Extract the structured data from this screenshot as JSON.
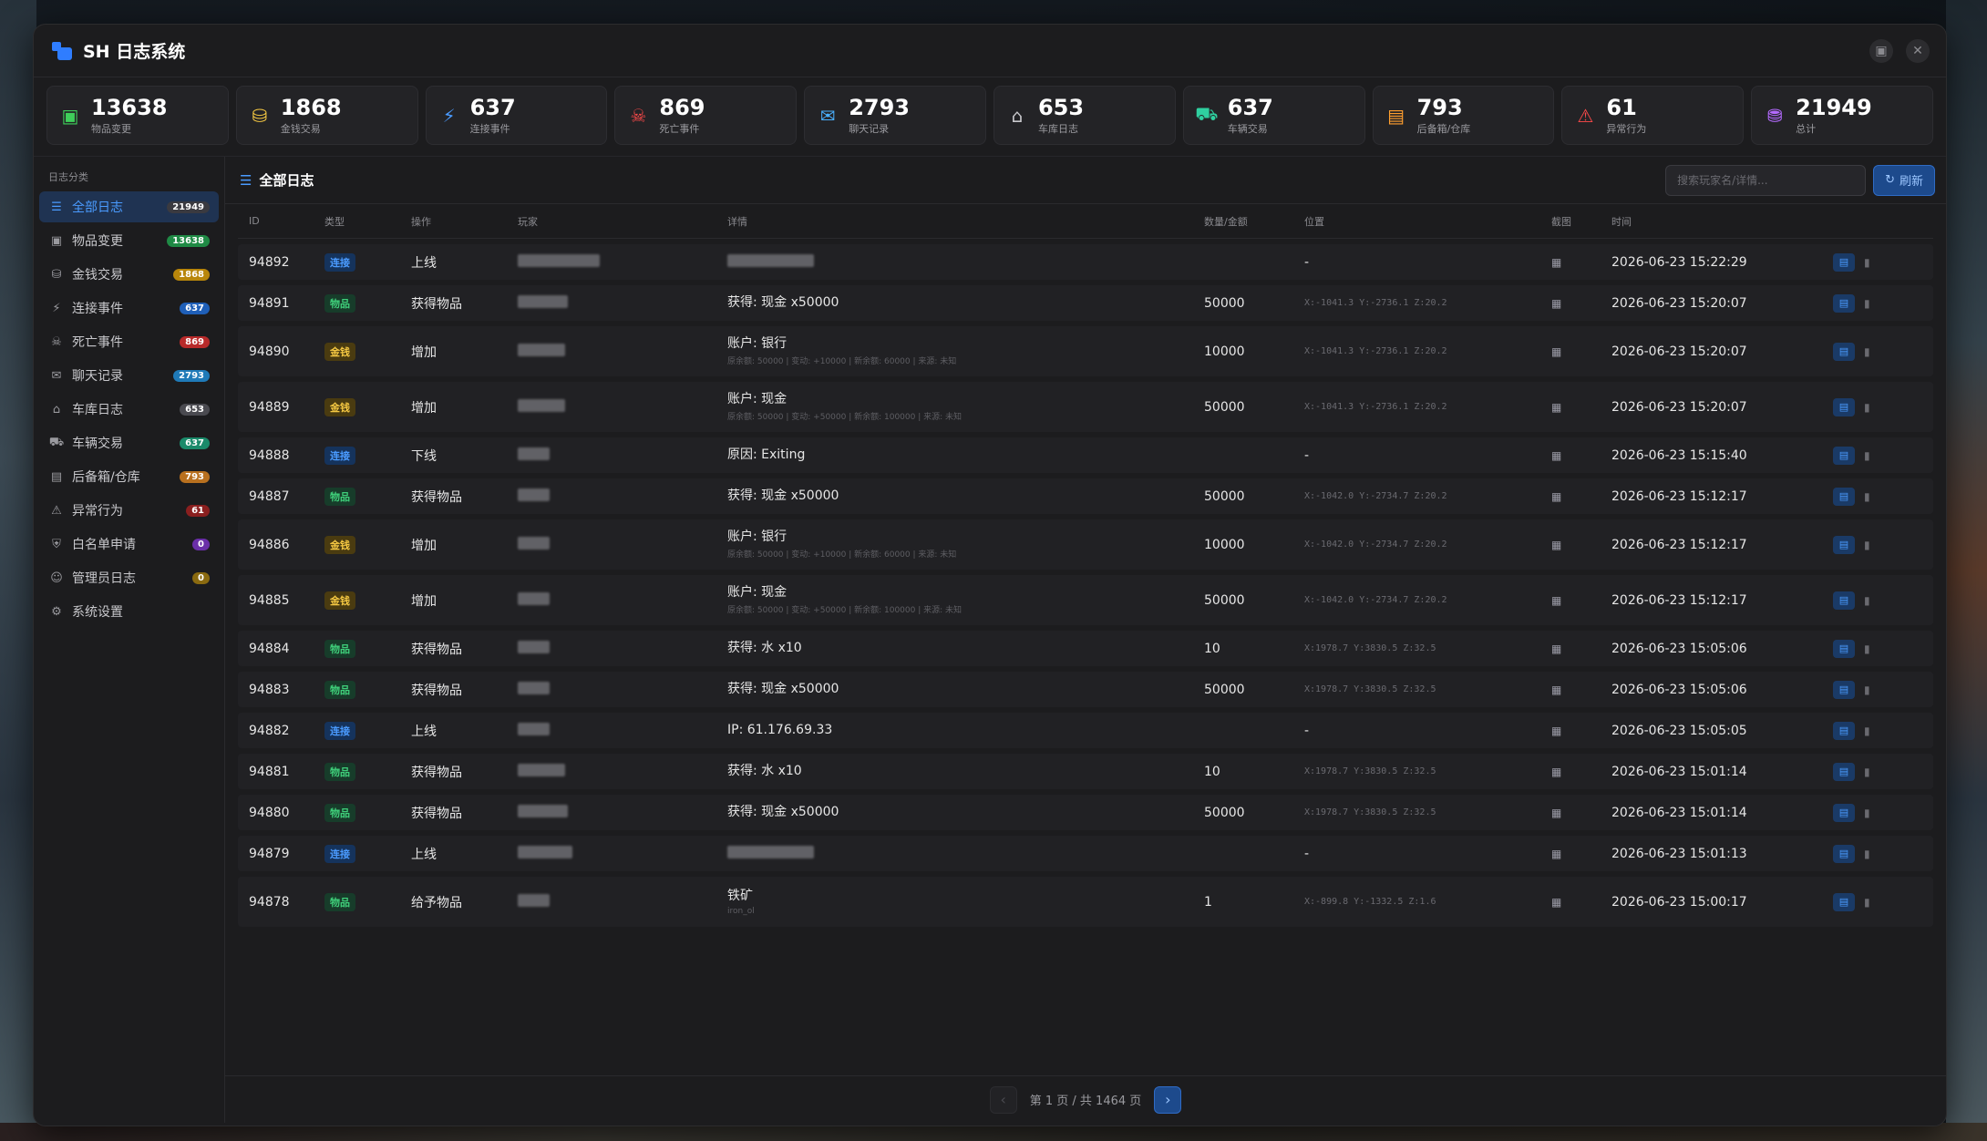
{
  "window": {
    "title": "SH 日志系统"
  },
  "stats": [
    {
      "value": "13638",
      "label": "物品变更",
      "icon": "box-icon",
      "color": "#3fcf5a"
    },
    {
      "value": "1868",
      "label": "金钱交易",
      "icon": "coins-icon",
      "color": "#f5c842"
    },
    {
      "value": "637",
      "label": "连接事件",
      "icon": "plug-icon",
      "color": "#4a9bff"
    },
    {
      "value": "869",
      "label": "死亡事件",
      "icon": "skull-icon",
      "color": "#ff4a4a"
    },
    {
      "value": "2793",
      "label": "聊天记录",
      "icon": "chat-icon",
      "color": "#4ab0ff"
    },
    {
      "value": "653",
      "label": "车库日志",
      "icon": "garage-icon",
      "color": "#c8c8cc"
    },
    {
      "value": "637",
      "label": "车辆交易",
      "icon": "car-icon",
      "color": "#2fd0a0"
    },
    {
      "value": "793",
      "label": "后备箱/仓库",
      "icon": "warehouse-icon",
      "color": "#ff9f2f"
    },
    {
      "value": "61",
      "label": "异常行为",
      "icon": "warning-icon",
      "color": "#ff4a4a"
    },
    {
      "value": "21949",
      "label": "总计",
      "icon": "database-icon",
      "color": "#b46aff"
    }
  ],
  "sidebar": {
    "category": "日志分类",
    "items": [
      {
        "label": "全部日志",
        "count": "21949",
        "icon": "list-icon",
        "badge": "#3a3a40",
        "active": true
      },
      {
        "label": "物品变更",
        "count": "13638",
        "icon": "box-icon",
        "badge": "#1f8a45"
      },
      {
        "label": "金钱交易",
        "count": "1868",
        "icon": "coins-icon",
        "badge": "#b8860b"
      },
      {
        "label": "连接事件",
        "count": "637",
        "icon": "plug-icon",
        "badge": "#1f5fb8"
      },
      {
        "label": "死亡事件",
        "count": "869",
        "icon": "skull-icon",
        "badge": "#b82a2a"
      },
      {
        "label": "聊天记录",
        "count": "2793",
        "icon": "chat-icon",
        "badge": "#1f7ab8"
      },
      {
        "label": "车库日志",
        "count": "653",
        "icon": "garage-icon",
        "badge": "#4a4a50"
      },
      {
        "label": "车辆交易",
        "count": "637",
        "icon": "car-icon",
        "badge": "#1a8a6a"
      },
      {
        "label": "后备箱/仓库",
        "count": "793",
        "icon": "warehouse-icon",
        "badge": "#b8701f"
      },
      {
        "label": "异常行为",
        "count": "61",
        "icon": "warning-icon",
        "badge": "#8a1f1f"
      },
      {
        "label": "白名单申请",
        "count": "0",
        "icon": "shield-icon",
        "badge": "#6a2fa8"
      },
      {
        "label": "管理员日志",
        "count": "0",
        "icon": "admin-icon",
        "badge": "#8a6a10"
      },
      {
        "label": "系统设置",
        "count": "",
        "icon": "gear-icon",
        "badge": ""
      }
    ]
  },
  "main": {
    "title": "全部日志",
    "search_placeholder": "搜索玩家名/详情...",
    "refresh_label": "刷新",
    "columns": [
      "ID",
      "类型",
      "操作",
      "玩家",
      "详情",
      "数量/金额",
      "位置",
      "截图",
      "时间"
    ]
  },
  "rows": [
    {
      "id": "94892",
      "type": "连接",
      "kind": "conn",
      "op": "上线",
      "detail": "",
      "sub": "",
      "amount": "",
      "pos": "-",
      "time": "2026-06-23 15:22:29",
      "blur": 90
    },
    {
      "id": "94891",
      "type": "物品",
      "kind": "item",
      "op": "获得物品",
      "detail": "获得: 现金 x50000",
      "sub": "",
      "amount": "50000",
      "pos": "X:-1041.3 Y:-2736.1 Z:20.2",
      "time": "2026-06-23 15:20:07",
      "blur": 55
    },
    {
      "id": "94890",
      "type": "金钱",
      "kind": "money",
      "op": "增加",
      "detail": "账户: 银行",
      "sub": "原余额: 50000 | 变动: +10000 | 新余额: 60000 | 来源: 未知",
      "amount": "10000",
      "pos": "X:-1041.3 Y:-2736.1 Z:20.2",
      "time": "2026-06-23 15:20:07",
      "blur": 52
    },
    {
      "id": "94889",
      "type": "金钱",
      "kind": "money",
      "op": "增加",
      "detail": "账户: 现金",
      "sub": "原余额: 50000 | 变动: +50000 | 新余额: 100000 | 来源: 未知",
      "amount": "50000",
      "pos": "X:-1041.3 Y:-2736.1 Z:20.2",
      "time": "2026-06-23 15:20:07",
      "blur": 52
    },
    {
      "id": "94888",
      "type": "连接",
      "kind": "conn",
      "op": "下线",
      "detail": "原因: Exiting",
      "sub": "",
      "amount": "",
      "pos": "-",
      "time": "2026-06-23 15:15:40",
      "blur": 35
    },
    {
      "id": "94887",
      "type": "物品",
      "kind": "item",
      "op": "获得物品",
      "detail": "获得: 现金 x50000",
      "sub": "",
      "amount": "50000",
      "pos": "X:-1042.0 Y:-2734.7 Z:20.2",
      "time": "2026-06-23 15:12:17",
      "blur": 35
    },
    {
      "id": "94886",
      "type": "金钱",
      "kind": "money",
      "op": "增加",
      "detail": "账户: 银行",
      "sub": "原余额: 50000 | 变动: +10000 | 新余额: 60000 | 来源: 未知",
      "amount": "10000",
      "pos": "X:-1042.0 Y:-2734.7 Z:20.2",
      "time": "2026-06-23 15:12:17",
      "blur": 35
    },
    {
      "id": "94885",
      "type": "金钱",
      "kind": "money",
      "op": "增加",
      "detail": "账户: 现金",
      "sub": "原余额: 50000 | 变动: +50000 | 新余额: 100000 | 来源: 未知",
      "amount": "50000",
      "pos": "X:-1042.0 Y:-2734.7 Z:20.2",
      "time": "2026-06-23 15:12:17",
      "blur": 35
    },
    {
      "id": "94884",
      "type": "物品",
      "kind": "item",
      "op": "获得物品",
      "detail": "获得: 水 x10",
      "sub": "",
      "amount": "10",
      "pos": "X:1978.7 Y:3830.5 Z:32.5",
      "time": "2026-06-23 15:05:06",
      "blur": 35
    },
    {
      "id": "94883",
      "type": "物品",
      "kind": "item",
      "op": "获得物品",
      "detail": "获得: 现金 x50000",
      "sub": "",
      "amount": "50000",
      "pos": "X:1978.7 Y:3830.5 Z:32.5",
      "time": "2026-06-23 15:05:06",
      "blur": 35
    },
    {
      "id": "94882",
      "type": "连接",
      "kind": "conn",
      "op": "上线",
      "detail": "IP: 61.176.69.33",
      "sub": "",
      "amount": "",
      "pos": "-",
      "time": "2026-06-23 15:05:05",
      "blur": 35
    },
    {
      "id": "94881",
      "type": "物品",
      "kind": "item",
      "op": "获得物品",
      "detail": "获得: 水 x10",
      "sub": "",
      "amount": "10",
      "pos": "X:1978.7 Y:3830.5 Z:32.5",
      "time": "2026-06-23 15:01:14",
      "blur": 52
    },
    {
      "id": "94880",
      "type": "物品",
      "kind": "item",
      "op": "获得物品",
      "detail": "获得: 现金 x50000",
      "sub": "",
      "amount": "50000",
      "pos": "X:1978.7 Y:3830.5 Z:32.5",
      "time": "2026-06-23 15:01:14",
      "blur": 55
    },
    {
      "id": "94879",
      "type": "连接",
      "kind": "conn",
      "op": "上线",
      "detail": "",
      "sub": "",
      "amount": "",
      "pos": "-",
      "time": "2026-06-23 15:01:13",
      "blur": 60
    },
    {
      "id": "94878",
      "type": "物品",
      "kind": "item",
      "op": "给予物品",
      "detail": "铁矿",
      "sub": "iron_ol",
      "amount": "1",
      "pos": "X:-899.8 Y:-1332.5 Z:1.6",
      "time": "2026-06-23 15:00:17",
      "blur": 35
    }
  ],
  "pagination": {
    "text": "第 1 页 / 共 1464 页"
  }
}
